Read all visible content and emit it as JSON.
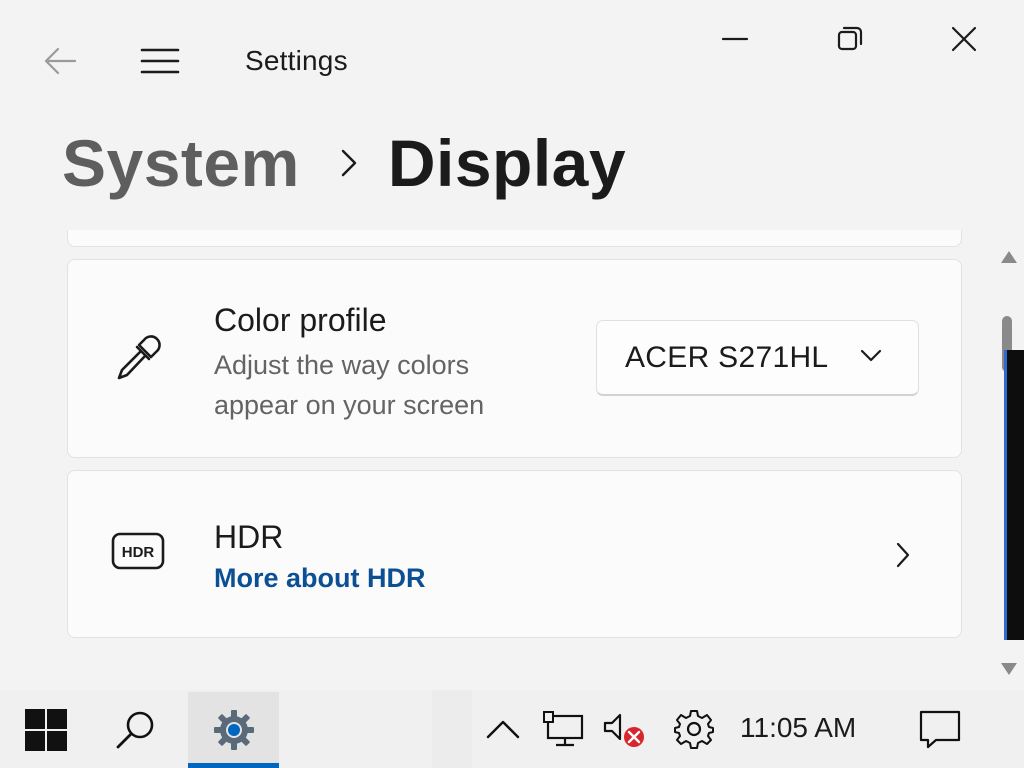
{
  "window": {
    "title": "Settings",
    "controls": [
      "minimize",
      "restore",
      "close"
    ]
  },
  "breadcrumb": {
    "parent": "System",
    "current": "Display"
  },
  "color_profile": {
    "title": "Color profile",
    "description": "Adjust the way colors appear on your screen",
    "selected": "ACER S271HL",
    "icon": "eyedropper-icon"
  },
  "hdr": {
    "title": "HDR",
    "link": "More about HDR",
    "icon": "hdr-icon"
  },
  "taskbar": {
    "time": "11:05 AM",
    "active_app": "Settings"
  },
  "colors": {
    "accent": "#0067c0",
    "link": "#0b4f94",
    "background": "#f3f3f3",
    "card": "#fbfbfb"
  }
}
